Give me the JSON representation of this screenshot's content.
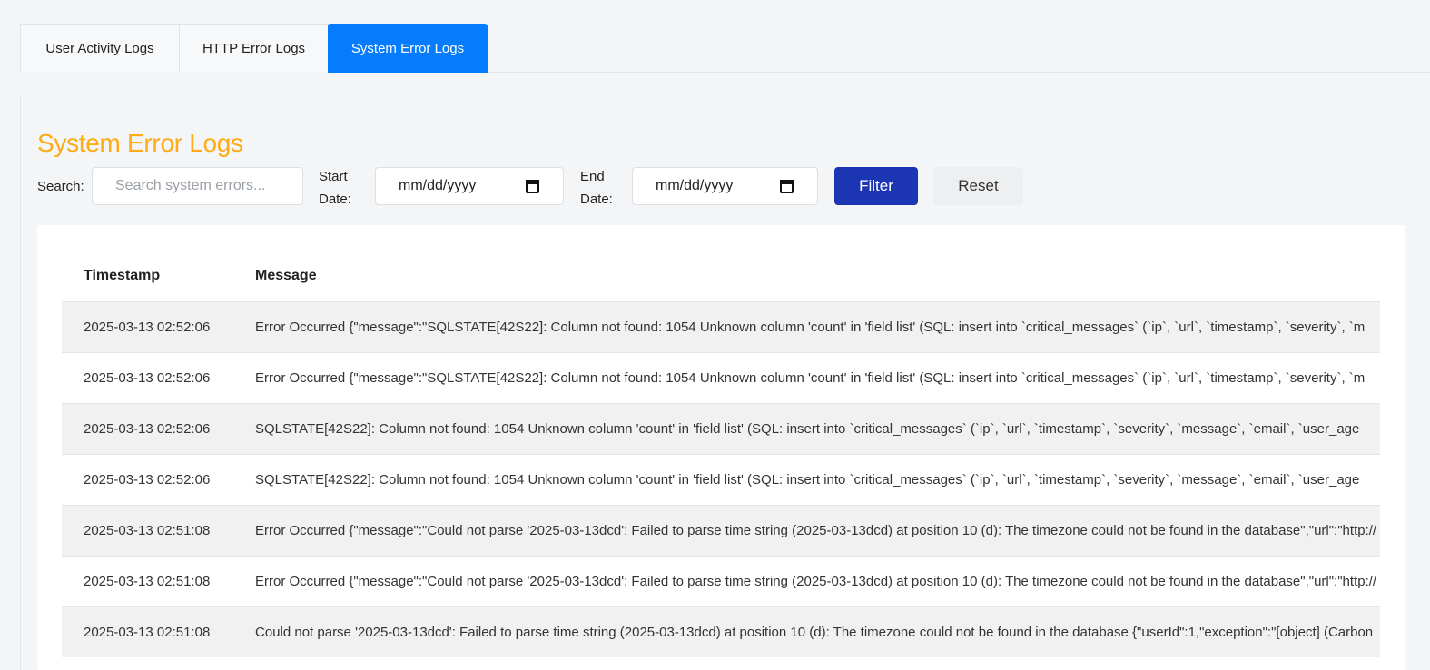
{
  "tabs": [
    {
      "label": "User Activity Logs",
      "active": false
    },
    {
      "label": "HTTP Error Logs",
      "active": false
    },
    {
      "label": "System Error Logs",
      "active": true
    }
  ],
  "section": {
    "title": "System Error Logs"
  },
  "filters": {
    "search_label": "Search:",
    "search_placeholder": "Search system errors...",
    "start_label": "Start Date:",
    "start_value": "mm/dd/yyyy",
    "end_label": "End Date:",
    "end_value": "mm/dd/yyyy",
    "filter_button": "Filter",
    "reset_button": "Reset"
  },
  "table": {
    "headers": {
      "timestamp": "Timestamp",
      "message": "Message"
    },
    "rows": [
      {
        "timestamp": "2025-03-13 02:52:06",
        "message": "Error Occurred {\"message\":\"SQLSTATE[42S22]: Column not found: 1054 Unknown column 'count' in 'field list' (SQL: insert into `critical_messages` (`ip`, `url`, `timestamp`, `severity`, `m"
      },
      {
        "timestamp": "2025-03-13 02:52:06",
        "message": "Error Occurred {\"message\":\"SQLSTATE[42S22]: Column not found: 1054 Unknown column 'count' in 'field list' (SQL: insert into `critical_messages` (`ip`, `url`, `timestamp`, `severity`, `m"
      },
      {
        "timestamp": "2025-03-13 02:52:06",
        "message": "SQLSTATE[42S22]: Column not found: 1054 Unknown column 'count' in 'field list' (SQL: insert into `critical_messages` (`ip`, `url`, `timestamp`, `severity`, `message`, `email`, `user_age"
      },
      {
        "timestamp": "2025-03-13 02:52:06",
        "message": "SQLSTATE[42S22]: Column not found: 1054 Unknown column 'count' in 'field list' (SQL: insert into `critical_messages` (`ip`, `url`, `timestamp`, `severity`, `message`, `email`, `user_age"
      },
      {
        "timestamp": "2025-03-13 02:51:08",
        "message": "Error Occurred {\"message\":\"Could not parse '2025-03-13dcd': Failed to parse time string (2025-03-13dcd) at position 10 (d): The timezone could not be found in the database\",\"url\":\"http://"
      },
      {
        "timestamp": "2025-03-13 02:51:08",
        "message": "Error Occurred {\"message\":\"Could not parse '2025-03-13dcd': Failed to parse time string (2025-03-13dcd) at position 10 (d): The timezone could not be found in the database\",\"url\":\"http://"
      },
      {
        "timestamp": "2025-03-13 02:51:08",
        "message": "Could not parse '2025-03-13dcd': Failed to parse time string (2025-03-13dcd) at position 10 (d): The timezone could not be found in the database {\"userId\":1,\"exception\":\"[object] (Carbon"
      }
    ]
  },
  "colors": {
    "accent": "#057bfd",
    "title": "#ffab16",
    "filter_button": "#1c36b3"
  }
}
